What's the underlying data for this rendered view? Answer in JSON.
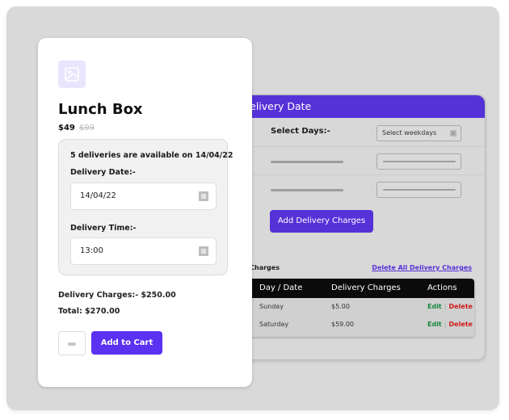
{
  "admin_panel": {
    "header_title": "Set Delivery Date",
    "select_days_label": "Select Days:-",
    "select_days_placeholder": "Select weekdays",
    "add_charges_button": "Add Delivery Charges",
    "charges_section_title": "Delivery Charges",
    "delete_all_link": "Delete All Delivery Charges",
    "table": {
      "columns": [
        "Day / Date",
        "Delivery Charges",
        "Actions"
      ],
      "rows": [
        {
          "day": "Sunday",
          "charge": "$5.00",
          "edit": "Edit",
          "delete": "Delete"
        },
        {
          "day": "Saturday",
          "charge": "$59.00",
          "edit": "Edit",
          "delete": "Delete"
        }
      ]
    },
    "accent_color": "#5531d8"
  },
  "product": {
    "image_icon": "image-icon",
    "title": "Lunch Box",
    "price": "$49",
    "old_price": "$99",
    "availability": "5 deliveries are available on 14/04/22",
    "delivery_date_label": "Delivery Date:-",
    "delivery_date_value": "14/04/22",
    "delivery_time_label": "Delivery Time:-",
    "delivery_time_value": "13:00",
    "delivery_charges": "Delivery Charges:- $250.00",
    "total": "Total: $270.00",
    "add_to_cart": "Add to Cart",
    "button_color": "#5b31f2"
  }
}
